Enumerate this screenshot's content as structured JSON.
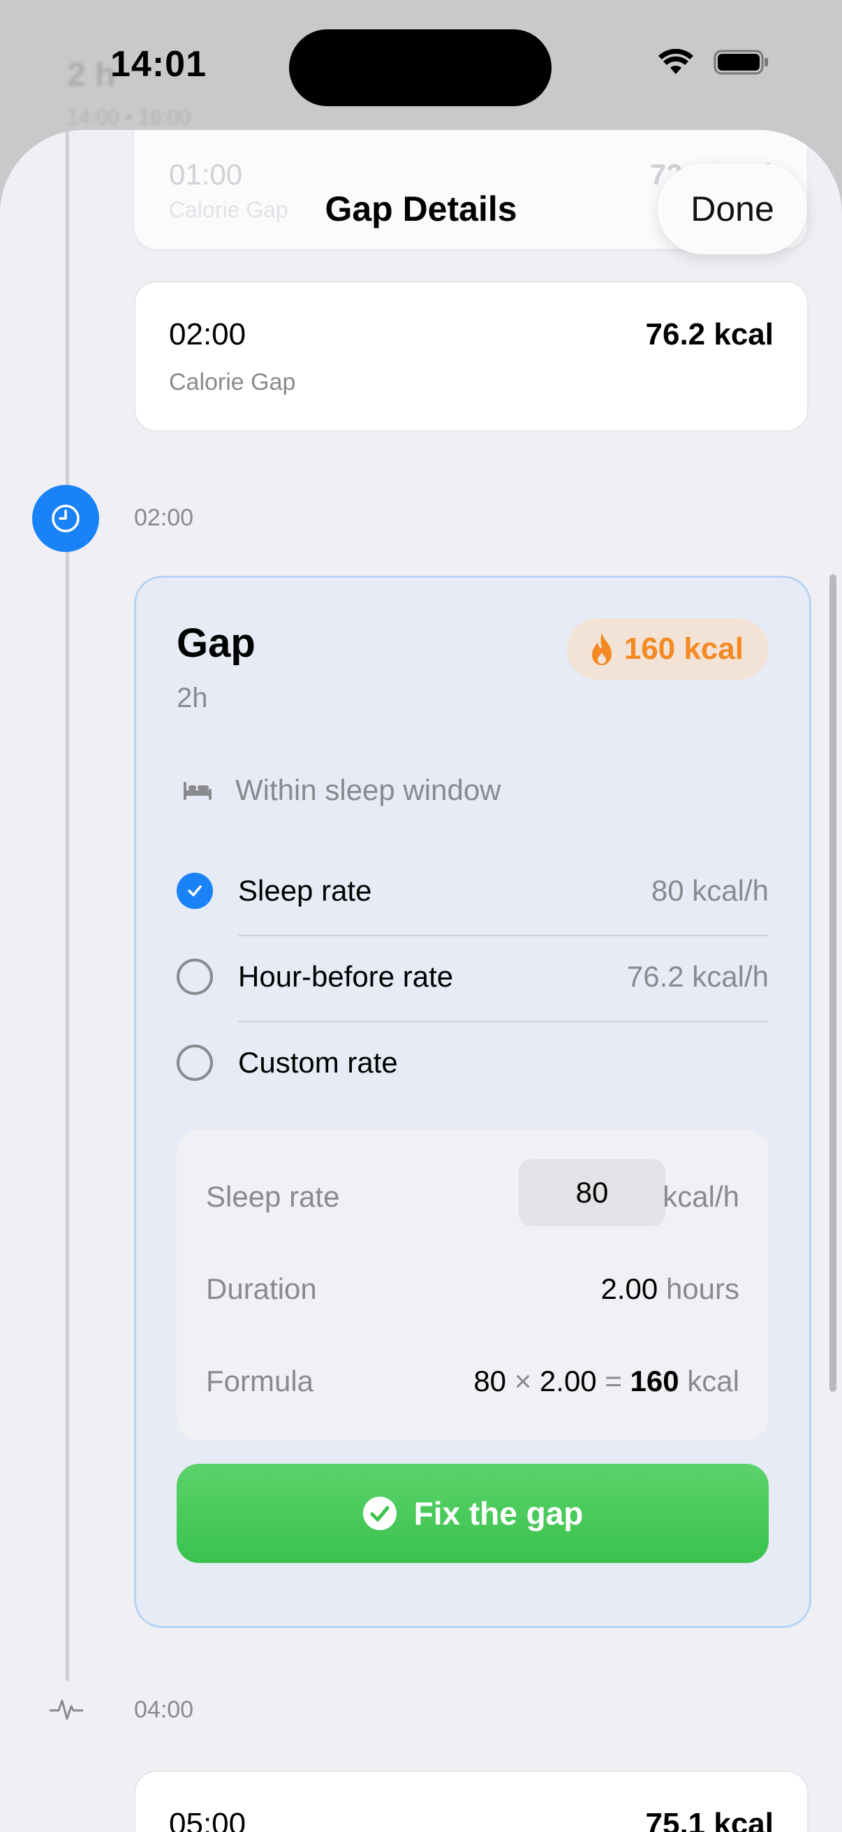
{
  "status_bar": {
    "time": "14:01"
  },
  "background_ghost": {
    "title": "2 h",
    "subtitle": "14:00 • 16:00"
  },
  "nav": {
    "title": "Gap Details",
    "done_label": "Done"
  },
  "ghost_entry": {
    "time": "01:00",
    "kcal": "72.3 kcal",
    "label": "Calorie Gap"
  },
  "entry_0200": {
    "time": "02:00",
    "kcal": "76.2 kcal",
    "label": "Calorie Gap"
  },
  "timeline": {
    "marker_time_1": "02:00",
    "marker_time_2": "04:00"
  },
  "gap": {
    "title": "Gap",
    "duration": "2h",
    "badge_kcal": "160 kcal",
    "sleep_window_text": "Within sleep window",
    "options": [
      {
        "label": "Sleep rate",
        "rate": "80 kcal/h",
        "selected": true
      },
      {
        "label": "Hour-before rate",
        "rate": "76.2 kcal/h",
        "selected": false
      },
      {
        "label": "Custom rate",
        "rate": "",
        "selected": false
      }
    ],
    "calc": {
      "rate_label": "Sleep rate",
      "rate_value": "80",
      "rate_unit": "kcal/h",
      "duration_label": "Duration",
      "duration_value": "2.00",
      "duration_unit": "hours",
      "formula_label": "Formula",
      "formula_a": "80",
      "formula_op": "×",
      "formula_b": "2.00",
      "formula_eq": "=",
      "formula_result": "160",
      "formula_unit": "kcal"
    },
    "fix_button_label": "Fix the gap"
  },
  "entry_0500": {
    "time": "05:00",
    "kcal": "75.1 kcal"
  },
  "colors": {
    "accent": "#1a82f7",
    "success": "#3ac24d",
    "flame": "#f48a23"
  }
}
